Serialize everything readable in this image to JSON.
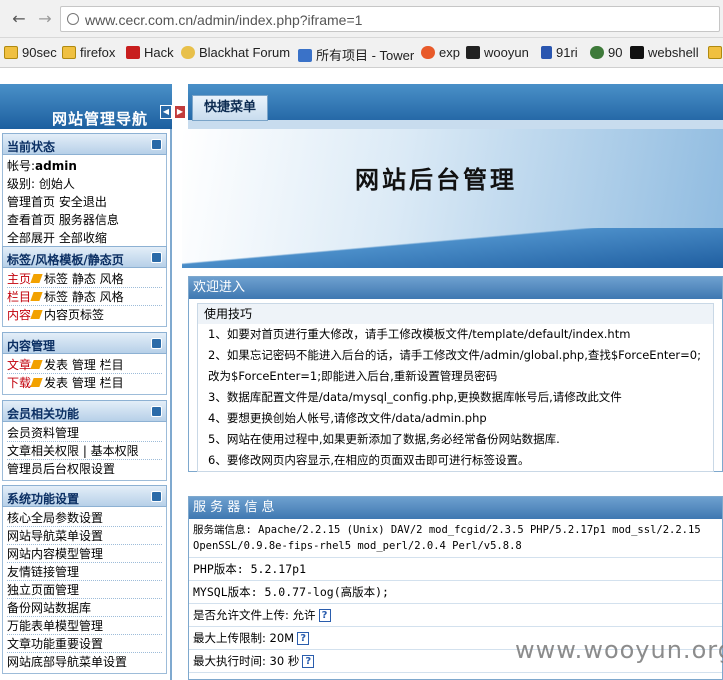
{
  "browser": {
    "url": "www.cecr.com.cn/admin/index.php?iframe=1",
    "bookmarks": [
      {
        "label": "90sec",
        "icon": "folder-icon"
      },
      {
        "label": "firefox",
        "icon": "folder-icon"
      },
      {
        "label": "Hack",
        "icon": "red-hat-icon"
      },
      {
        "label": "Blackhat Forum",
        "icon": "badge-icon"
      },
      {
        "label": "所有项目 - Tower",
        "icon": "tower-icon"
      },
      {
        "label": "exp",
        "icon": "bird-icon"
      },
      {
        "label": "wooyun",
        "icon": "wooyun-icon"
      },
      {
        "label": "91ri",
        "icon": "shield-icon"
      },
      {
        "label": "90",
        "icon": "skull-icon"
      },
      {
        "label": "webshell",
        "icon": "terminal-icon"
      }
    ]
  },
  "header": {
    "nav_title": "网站管理导航",
    "tab_label": "快捷菜单"
  },
  "sidebar": {
    "status": {
      "title": "当前状态",
      "account_label": "帐号:",
      "account_value": "admin",
      "level": "级别: 创始人",
      "row1": "管理首页  安全退出",
      "row2": "查看首页  服务器信息",
      "row3": "全部展开  全部收缩"
    },
    "template": {
      "title": "标签/风格模板/静态页",
      "rows": [
        {
          "red": "主页",
          "rest": "标签  静态  风格"
        },
        {
          "red": "栏目",
          "rest": "标签  静态  风格"
        },
        {
          "red": "内容",
          "rest": "内容页标签"
        }
      ]
    },
    "content": {
      "title": "内容管理",
      "rows": [
        {
          "red": "文章",
          "rest": "发表  管理  栏目"
        },
        {
          "red": "下载",
          "rest": "发表  管理  栏目"
        }
      ]
    },
    "member": {
      "title": "会员相关功能",
      "items": [
        "会员资料管理",
        "文章相关权限 | 基本权限",
        "管理员后台权限设置"
      ]
    },
    "system": {
      "title": "系统功能设置",
      "items": [
        "核心全局参数设置",
        "网站导航菜单设置",
        "网站内容模型管理",
        "友情链接管理",
        "独立页面管理",
        "备份网站数据库",
        "万能表单模型管理",
        "文章功能重要设置",
        "网站底部导航菜单设置"
      ]
    }
  },
  "main": {
    "banner_title": "网站后台管理",
    "welcome": {
      "title": "欢迎进入",
      "tips_title": "使用技巧",
      "tips": [
        "1、如要对首页进行重大修改，请手工修改模板文件/template/default/index.htm",
        "2、如果忘记密码不能进入后台的话，请手工修改文件/admin/global.php,查找$ForceEnter=0;改为$ForceEnter=1;即能进入后台,重新设置管理员密码",
        "3、数据库配置文件是/data/mysql_config.php,更换数据库帐号后,请修改此文件",
        "4、要想更换创始人帐号,请修改文件/data/admin.php",
        "5、网站在使用过程中,如果更新添加了数据,务必经常备份网站数据库.",
        "6、要修改网页内容显示,在相应的页面双击即可进行标签设置。"
      ]
    },
    "server": {
      "title": "服 务 器 信 息",
      "software": "服务端信息: Apache/2.2.15 (Unix) DAV/2 mod_fcgid/2.3.5 PHP/5.2.17p1 mod_ssl/2.2.15",
      "software2": "OpenSSL/0.9.8e-fips-rhel5 mod_perl/2.0.4 Perl/v5.8.8",
      "php": "PHP版本: 5.2.17p1",
      "mysql": "MYSQL版本: 5.0.77-log(高版本);",
      "upload": "是否允许文件上传: 允许",
      "upload_limit": "最大上传限制: 20M",
      "exec_time": "最大执行时间: 30 秒"
    }
  },
  "watermark": "www.wooyun.org"
}
